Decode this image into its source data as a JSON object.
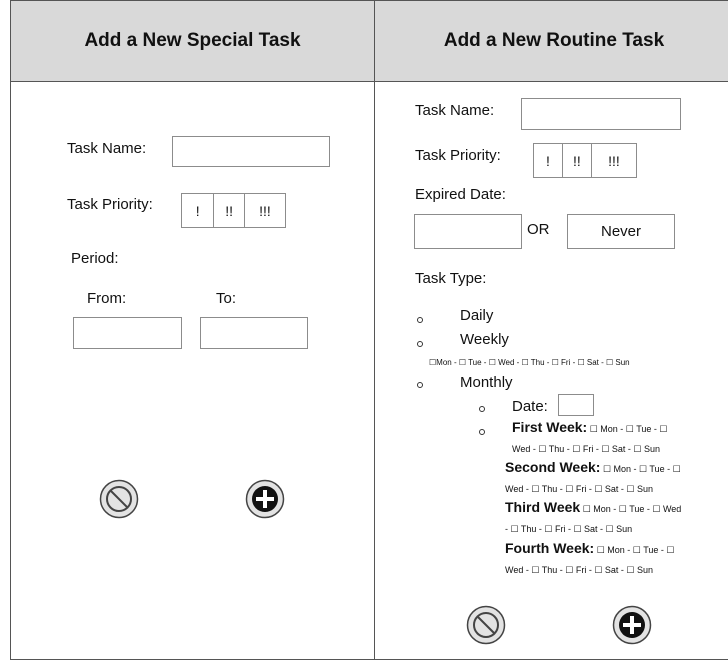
{
  "special": {
    "title": "Add a New Special Task",
    "task_name_label": "Task Name:",
    "task_priority_label": "Task Priority:",
    "priority_options": [
      "!",
      "!!",
      "!!!"
    ],
    "period_label": "Period:",
    "from_label": "From:",
    "to_label": "To:"
  },
  "routine": {
    "title": "Add a New Routine Task",
    "task_name_label": "Task Name:",
    "task_priority_label": "Task Priority:",
    "priority_options": [
      "!",
      "!!",
      "!!!"
    ],
    "expired_date_label": "Expired Date:",
    "or_label": "OR",
    "never_label": "Never",
    "task_type_label": "Task Type:",
    "daily_label": "Daily",
    "weekly_label": "Weekly",
    "weekly_days": "☐Mon - ☐ Tue - ☐ Wed - ☐ Thu - ☐ Fri - ☐ Sat - ☐ Sun",
    "monthly_label": "Monthly",
    "date_label": "Date:",
    "first_week_label": "First Week:",
    "first_week_days_1": "☐ Mon - ☐ Tue - ☐",
    "first_week_days_2": "Wed - ☐ Thu - ☐ Fri - ☐ Sat - ☐ Sun",
    "second_week_label": "Second Week:",
    "second_week_days_1": "☐ Mon - ☐ Tue - ☐",
    "second_week_days_2": "Wed - ☐ Thu - ☐ Fri - ☐ Sat - ☐ Sun",
    "third_week_label": "Third Week",
    "third_week_days_1": "☐ Mon - ☐ Tue - ☐ Wed",
    "third_week_days_2": "- ☐ Thu - ☐ Fri - ☐ Sat - ☐ Sun",
    "fourth_week_label": "Fourth Week:",
    "fourth_week_days_1": "☐ Mon - ☐ Tue - ☐",
    "fourth_week_days_2": "Wed - ☐ Thu - ☐ Fri - ☐ Sat - ☐ Sun"
  },
  "icons": {
    "cancel": "cancel-icon",
    "add": "add-icon"
  }
}
